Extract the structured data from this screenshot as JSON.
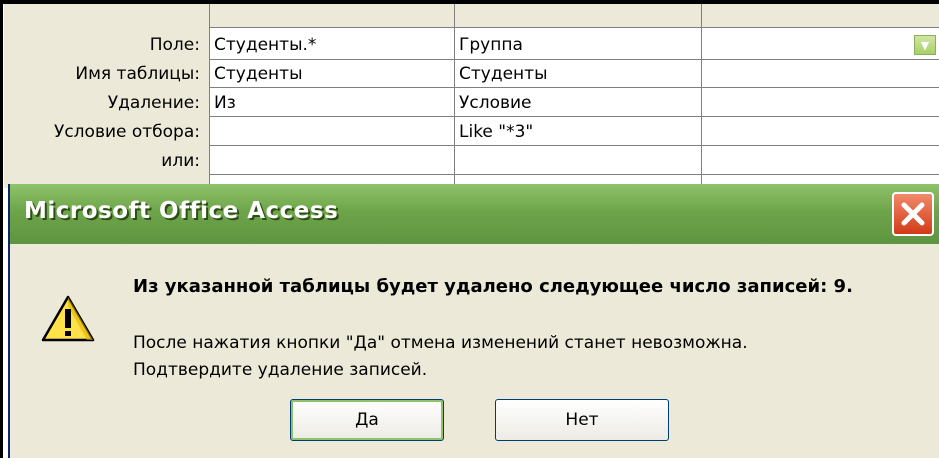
{
  "grid": {
    "rows": [
      {
        "label": "Поле:",
        "col1": "Студенты.*",
        "col2": "Группа",
        "col3": ""
      },
      {
        "label": "Имя таблицы:",
        "col1": "Студенты",
        "col2": "Студенты",
        "col3": ""
      },
      {
        "label": "Удаление:",
        "col1": "Из",
        "col2": "Условие",
        "col3": ""
      },
      {
        "label": "Условие отбора:",
        "col1": "",
        "col2": "Like \"*3\"",
        "col3": ""
      },
      {
        "label": "или:",
        "col1": "",
        "col2": "",
        "col3": ""
      }
    ],
    "dropdown_icon": "chevron-down-icon"
  },
  "dialog": {
    "title": "Microsoft Office Access",
    "close_icon": "close-icon",
    "warning_icon": "warning-icon",
    "message_bold": "Из указанной таблицы будет удалено следующее число записей: 9.",
    "message_line1": "После нажатия кнопки \"Да\" отмена изменений станет невозможна.",
    "message_line2": "Подтвердите удаление записей.",
    "yes_label": "Да",
    "no_label": "Нет"
  },
  "colors": {
    "titlebar": "#6ea54a",
    "close_button": "#d23b17",
    "dialog_bg": "#ece9d8"
  }
}
